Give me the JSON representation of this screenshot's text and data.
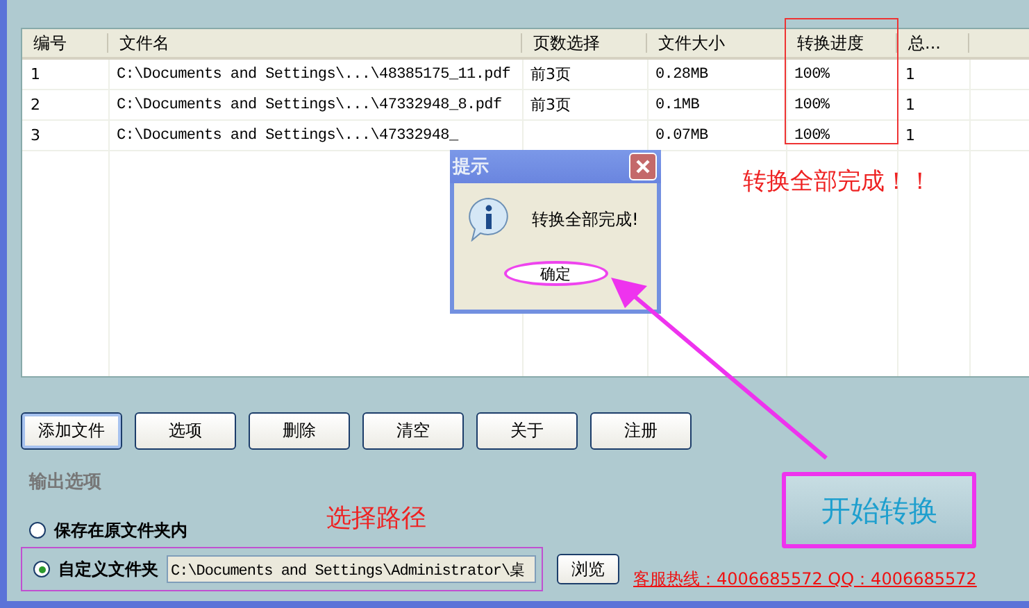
{
  "table": {
    "columns": [
      "编号",
      "文件名",
      "页数选择",
      "文件大小",
      "转换进度",
      "总..."
    ],
    "rows": [
      {
        "cells": [
          "1",
          "C:\\Documents and Settings\\...\\48385175_11.pdf",
          "前3页",
          "0.28MB",
          "100%",
          "1"
        ]
      },
      {
        "cells": [
          "2",
          "C:\\Documents and Settings\\...\\47332948_8.pdf",
          "前3页",
          "0.1MB",
          "100%",
          "1"
        ]
      },
      {
        "cells": [
          "3",
          "C:\\Documents and Settings\\...\\47332948_",
          "",
          "0.07MB",
          "100%",
          "1"
        ]
      }
    ]
  },
  "dialog": {
    "title": "提示",
    "message": "转换全部完成!",
    "ok": "确定"
  },
  "annotations": [
    {
      "kind": "done",
      "text": "转换全部完成！！"
    },
    {
      "kind": "path",
      "text": "选择路径"
    }
  ],
  "toolbar": [
    {
      "label": "添加文件",
      "focused": true
    },
    {
      "label": "选项",
      "focused": false
    },
    {
      "label": "删除",
      "focused": false
    },
    {
      "label": "清空",
      "focused": false
    },
    {
      "label": "关于",
      "focused": false
    },
    {
      "label": "注册",
      "focused": false
    }
  ],
  "output": {
    "heading": "输出选项",
    "options": [
      {
        "label": "保存在原文件夹内",
        "selected": false
      },
      {
        "label": "自定义文件夹",
        "selected": true
      }
    ],
    "path": "C:\\Documents and Settings\\Administrator\\桌",
    "browse": "浏览"
  },
  "start_button": "开始转换",
  "hotline": "客服热线：4006685572 QQ：4006685572"
}
